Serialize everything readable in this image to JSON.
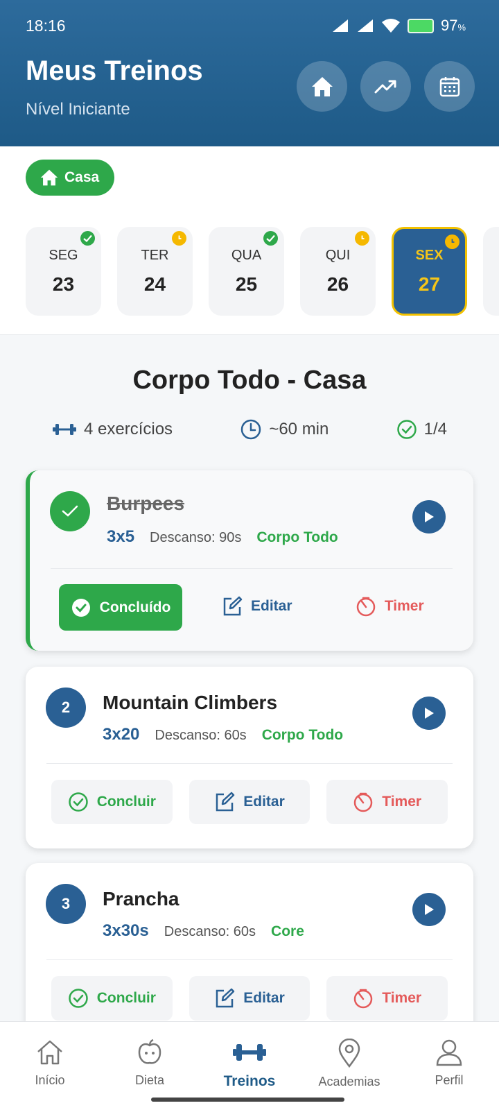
{
  "status_bar": {
    "time": "18:16",
    "battery": "97"
  },
  "header": {
    "title": "Meus Treinos",
    "subtitle": "Nível Iniciante",
    "buttons": [
      "home-icon",
      "trending-up-icon",
      "calendar-icon"
    ]
  },
  "location_chip": {
    "label": "Casa"
  },
  "days": [
    {
      "name": "SEG",
      "date": "23",
      "status": "done"
    },
    {
      "name": "TER",
      "date": "24",
      "status": "pending"
    },
    {
      "name": "QUA",
      "date": "25",
      "status": "done"
    },
    {
      "name": "QUI",
      "date": "26",
      "status": "pending"
    },
    {
      "name": "SEX",
      "date": "27",
      "status": "pending",
      "selected": true
    }
  ],
  "workout": {
    "title": "Corpo Todo - Casa",
    "exercises_count": "4 exercícios",
    "duration": "~60 min",
    "progress": "1/4"
  },
  "exercises": [
    {
      "number": "",
      "name": "Burpees",
      "sets": "3x5",
      "rest": "Descanso: 90s",
      "group": "Corpo Todo",
      "done": true,
      "actions": {
        "complete": "Concluído",
        "edit": "Editar",
        "timer": "Timer"
      }
    },
    {
      "number": "2",
      "name": "Mountain Climbers",
      "sets": "3x20",
      "rest": "Descanso: 60s",
      "group": "Corpo Todo",
      "done": false,
      "actions": {
        "complete": "Concluir",
        "edit": "Editar",
        "timer": "Timer"
      }
    },
    {
      "number": "3",
      "name": "Prancha",
      "sets": "3x30s",
      "rest": "Descanso: 60s",
      "group": "Core",
      "done": false,
      "actions": {
        "complete": "Concluir",
        "edit": "Editar",
        "timer": "Timer"
      }
    }
  ],
  "bottom_nav": [
    {
      "label": "Início",
      "icon": "home-icon"
    },
    {
      "label": "Dieta",
      "icon": "apple-icon"
    },
    {
      "label": "Treinos",
      "icon": "dumbbell-icon",
      "active": true
    },
    {
      "label": "Academias",
      "icon": "map-pin-icon"
    },
    {
      "label": "Perfil",
      "icon": "user-icon"
    }
  ],
  "colors": {
    "primary": "#2a6094",
    "success": "#2ea84a",
    "warning": "#f5b800",
    "danger": "#e45a5a"
  }
}
